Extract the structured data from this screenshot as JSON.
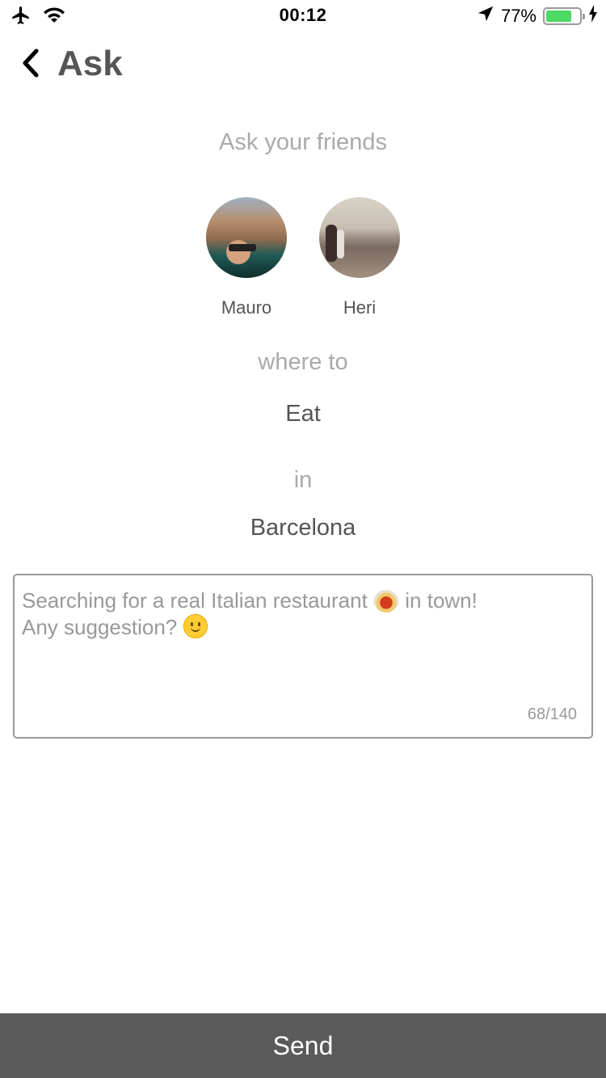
{
  "status_bar": {
    "time": "00:12",
    "battery_percent": "77%",
    "battery_level": 0.77,
    "icons": [
      "airplane-icon",
      "wifi-icon",
      "location-arrow-icon",
      "battery-icon",
      "charging-bolt-icon"
    ]
  },
  "nav": {
    "back_icon": "chevron-left-icon",
    "title": "Ask"
  },
  "main": {
    "subtitle": "Ask your friends",
    "friends": [
      {
        "name": "Mauro"
      },
      {
        "name": "Heri"
      }
    ],
    "where_label": "where to",
    "activity": "Eat",
    "in_label": "in",
    "city": "Barcelona"
  },
  "message": {
    "line1_a": "Searching for a real Italian restaurant ",
    "line1_b": " in town!",
    "line2": "Any suggestion? ",
    "counter": "68/140"
  },
  "footer": {
    "send_label": "Send"
  },
  "colors": {
    "send_bg": "#5a5a5a",
    "battery_fill": "#4cd964"
  }
}
